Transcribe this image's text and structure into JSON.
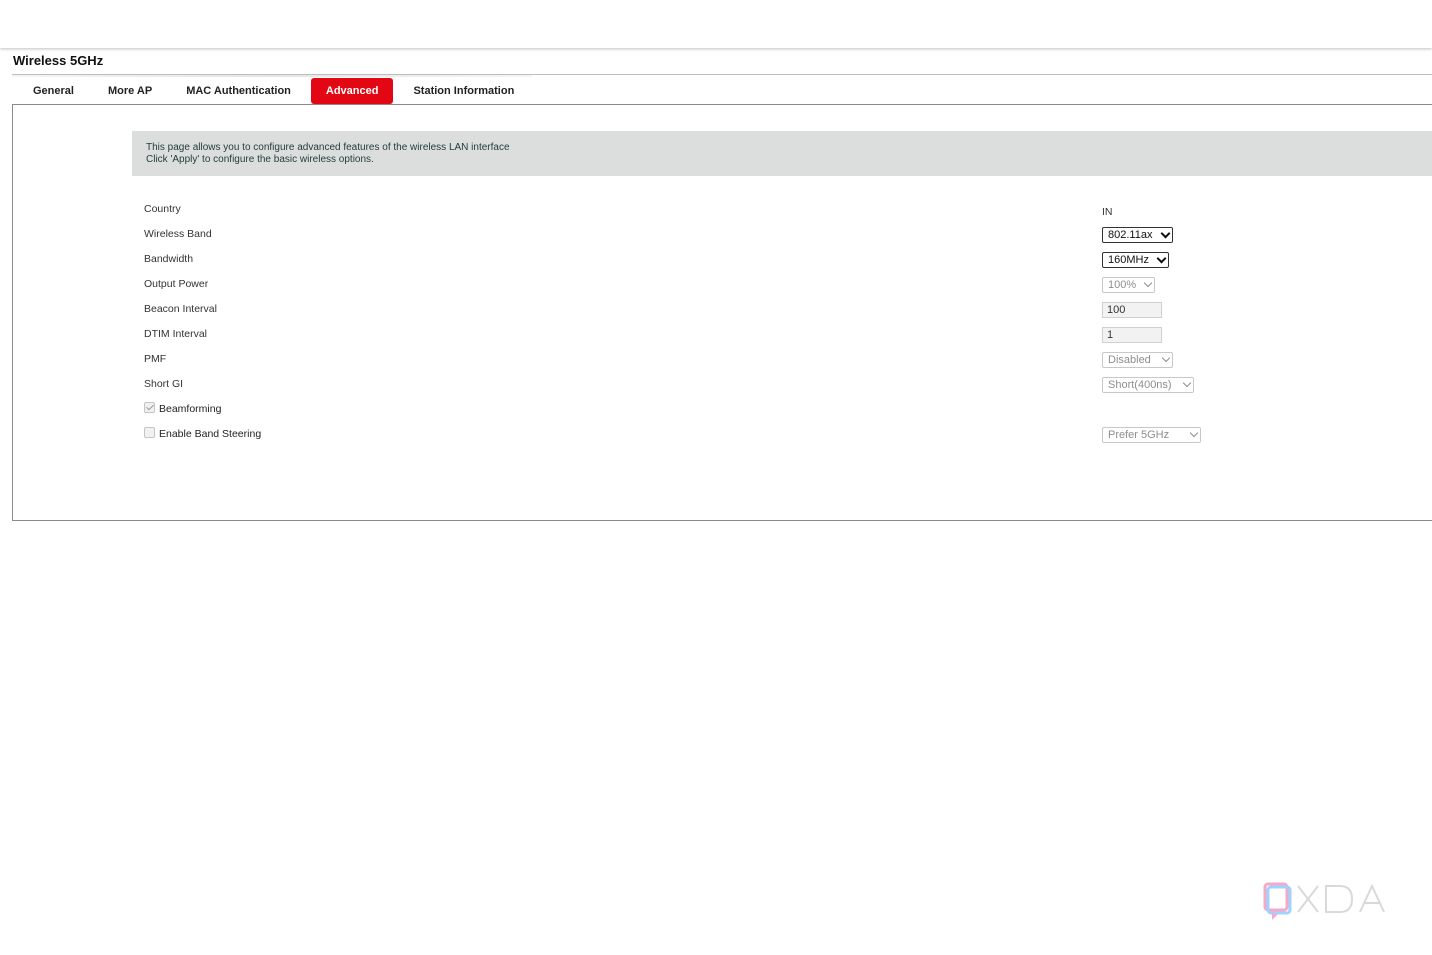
{
  "page": {
    "title": "Wireless 5GHz"
  },
  "tabs": [
    {
      "label": "General"
    },
    {
      "label": "More AP"
    },
    {
      "label": "MAC Authentication"
    },
    {
      "label": "Advanced",
      "active": true
    },
    {
      "label": "Station Information"
    }
  ],
  "info": {
    "line1": "This page allows you to configure advanced features of the wireless LAN interface",
    "line2": "Click 'Apply' to configure the basic wireless options."
  },
  "settings": {
    "country": {
      "label": "Country",
      "value": "IN"
    },
    "wireless_band": {
      "label": "Wireless Band",
      "value": "802.11ax"
    },
    "bandwidth": {
      "label": "Bandwidth",
      "value": "160MHz"
    },
    "output_power": {
      "label": "Output Power",
      "value": "100%"
    },
    "beacon_interval": {
      "label": "Beacon Interval",
      "value": "100"
    },
    "dtim_interval": {
      "label": "DTIM Interval",
      "value": "1"
    },
    "pmf": {
      "label": "PMF",
      "value": "Disabled"
    },
    "short_gi": {
      "label": "Short GI",
      "value": "Short(400ns)"
    },
    "beamforming": {
      "label": "Beamforming",
      "checked": true
    },
    "band_steering": {
      "label": "Enable Band Steering",
      "checked": false,
      "value": "Prefer 5GHz"
    }
  },
  "colors": {
    "accent": "#e30613",
    "banner_bg": "#dcdedd"
  },
  "watermark": {
    "icon": "xda-logo",
    "text": "XDA"
  }
}
